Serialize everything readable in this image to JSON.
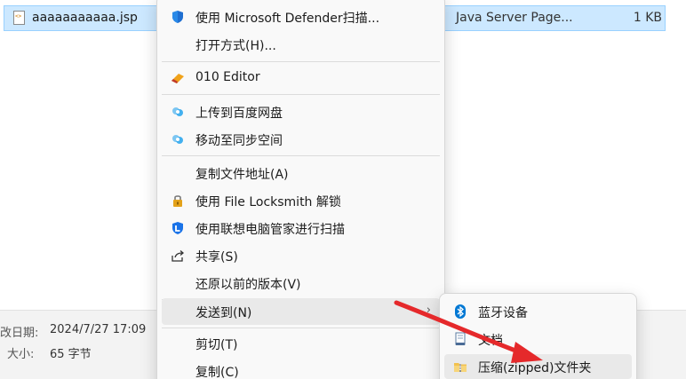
{
  "file": {
    "name": "aaaaaaaaaaa.jsp",
    "type": "Java Server Page...",
    "size": "1 KB"
  },
  "details": {
    "modified_label": "改日期:",
    "modified_value": "2024/7/27 17:09",
    "size_label": "大小:",
    "size_value": "65 字节"
  },
  "menu": {
    "items": [
      {
        "label": "使用 Microsoft Defender扫描...",
        "icon": "defender-icon"
      },
      {
        "label": "打开方式(H)...",
        "icon": ""
      },
      {
        "label": "010 Editor",
        "icon": "010-editor-icon"
      },
      {
        "label": "上传到百度网盘",
        "icon": "baidu-netdisk-icon"
      },
      {
        "label": "移动至同步空间",
        "icon": "baidu-netdisk-icon"
      },
      {
        "label": "复制文件地址(A)",
        "icon": ""
      },
      {
        "label": "使用 File Locksmith 解锁",
        "icon": "lock-icon"
      },
      {
        "label": "使用联想电脑管家进行扫描",
        "icon": "lenovo-shield-icon"
      },
      {
        "label": "共享(S)",
        "icon": "share-icon"
      },
      {
        "label": "还原以前的版本(V)",
        "icon": ""
      },
      {
        "label": "发送到(N)",
        "icon": ""
      },
      {
        "label": "剪切(T)",
        "icon": ""
      },
      {
        "label": "复制(C)",
        "icon": ""
      }
    ]
  },
  "submenu": {
    "items": [
      {
        "label": "蓝牙设备",
        "icon": "bluetooth-icon"
      },
      {
        "label": "文档",
        "icon": "document-icon"
      },
      {
        "label": "压缩(zipped)文件夹",
        "icon": "zip-folder-icon"
      }
    ]
  },
  "colors": {
    "selection": "#cce8ff",
    "menu_hover": "#e9e9e9",
    "annotation_arrow": "#e5292b",
    "bluetooth": "#0078d4"
  }
}
